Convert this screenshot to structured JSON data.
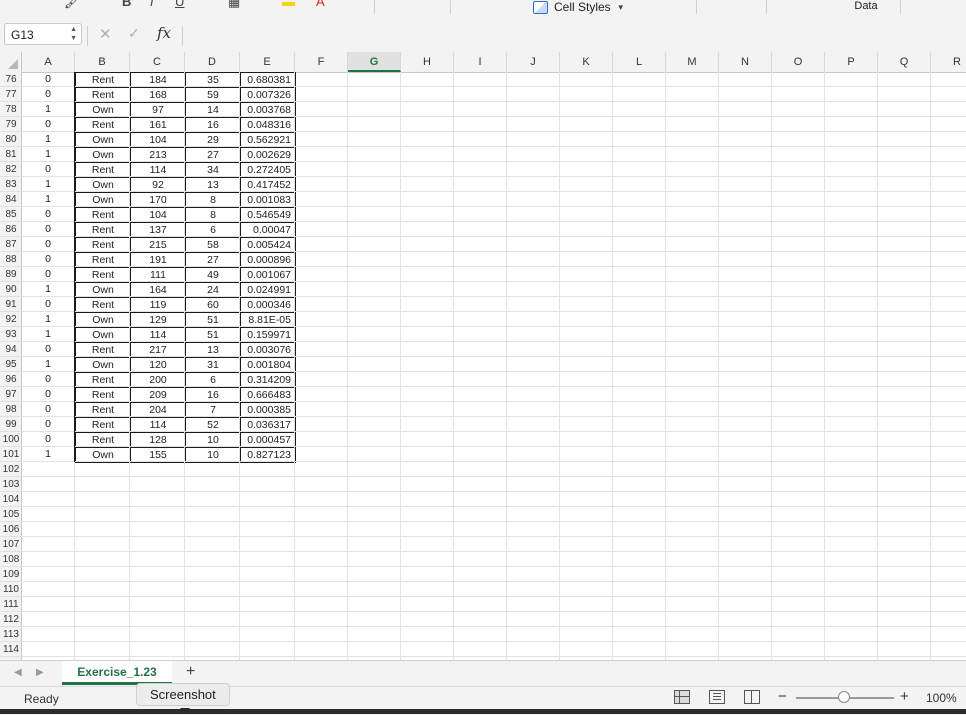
{
  "ribbon": {
    "cell_styles_label": "Cell Styles",
    "data_label": "Data"
  },
  "formula_bar": {
    "name_box": "G13",
    "fx_label": "fx",
    "formula_value": ""
  },
  "columns": [
    "A",
    "B",
    "C",
    "D",
    "E",
    "F",
    "G",
    "H",
    "I",
    "J",
    "K",
    "L",
    "M",
    "N",
    "O",
    "P",
    "Q",
    "R"
  ],
  "selected_column": "G",
  "rows": [
    {
      "n": "76",
      "a": "0",
      "b": "Rent",
      "c": "184",
      "d": "35",
      "e": "0.680381"
    },
    {
      "n": "77",
      "a": "0",
      "b": "Rent",
      "c": "168",
      "d": "59",
      "e": "0.007326"
    },
    {
      "n": "78",
      "a": "1",
      "b": "Own",
      "c": "97",
      "d": "14",
      "e": "0.003768"
    },
    {
      "n": "79",
      "a": "0",
      "b": "Rent",
      "c": "161",
      "d": "16",
      "e": "0.048316"
    },
    {
      "n": "80",
      "a": "1",
      "b": "Own",
      "c": "104",
      "d": "29",
      "e": "0.562921"
    },
    {
      "n": "81",
      "a": "1",
      "b": "Own",
      "c": "213",
      "d": "27",
      "e": "0.002629"
    },
    {
      "n": "82",
      "a": "0",
      "b": "Rent",
      "c": "114",
      "d": "34",
      "e": "0.272405"
    },
    {
      "n": "83",
      "a": "1",
      "b": "Own",
      "c": "92",
      "d": "13",
      "e": "0.417452"
    },
    {
      "n": "84",
      "a": "1",
      "b": "Own",
      "c": "170",
      "d": "8",
      "e": "0.001083"
    },
    {
      "n": "85",
      "a": "0",
      "b": "Rent",
      "c": "104",
      "d": "8",
      "e": "0.546549"
    },
    {
      "n": "86",
      "a": "0",
      "b": "Rent",
      "c": "137",
      "d": "6",
      "e": "0.00047"
    },
    {
      "n": "87",
      "a": "0",
      "b": "Rent",
      "c": "215",
      "d": "58",
      "e": "0.005424"
    },
    {
      "n": "88",
      "a": "0",
      "b": "Rent",
      "c": "191",
      "d": "27",
      "e": "0.000896"
    },
    {
      "n": "89",
      "a": "0",
      "b": "Rent",
      "c": "111",
      "d": "49",
      "e": "0.001067"
    },
    {
      "n": "90",
      "a": "1",
      "b": "Own",
      "c": "164",
      "d": "24",
      "e": "0.024991"
    },
    {
      "n": "91",
      "a": "0",
      "b": "Rent",
      "c": "119",
      "d": "60",
      "e": "0.000346"
    },
    {
      "n": "92",
      "a": "1",
      "b": "Own",
      "c": "129",
      "d": "51",
      "e": "8.81E-05"
    },
    {
      "n": "93",
      "a": "1",
      "b": "Own",
      "c": "114",
      "d": "51",
      "e": "0.159971"
    },
    {
      "n": "94",
      "a": "0",
      "b": "Rent",
      "c": "217",
      "d": "13",
      "e": "0.003076"
    },
    {
      "n": "95",
      "a": "1",
      "b": "Own",
      "c": "120",
      "d": "31",
      "e": "0.001804"
    },
    {
      "n": "96",
      "a": "0",
      "b": "Rent",
      "c": "200",
      "d": "6",
      "e": "0.314209"
    },
    {
      "n": "97",
      "a": "0",
      "b": "Rent",
      "c": "209",
      "d": "16",
      "e": "0.666483"
    },
    {
      "n": "98",
      "a": "0",
      "b": "Rent",
      "c": "204",
      "d": "7",
      "e": "0.000385"
    },
    {
      "n": "99",
      "a": "0",
      "b": "Rent",
      "c": "114",
      "d": "52",
      "e": "0.036317"
    },
    {
      "n": "100",
      "a": "0",
      "b": "Rent",
      "c": "128",
      "d": "10",
      "e": "0.000457"
    },
    {
      "n": "101",
      "a": "1",
      "b": "Own",
      "c": "155",
      "d": "10",
      "e": "0.827123"
    }
  ],
  "empty_rows": [
    "102",
    "103",
    "104",
    "105",
    "106",
    "107",
    "108",
    "109",
    "110",
    "111",
    "112",
    "113",
    "114"
  ],
  "sheet_tab": "Exercise_1.23",
  "add_sheet": "+",
  "status": {
    "ready": "Ready",
    "tooltip": "Screenshot",
    "zoom_minus": "−",
    "zoom_plus": "+",
    "zoom": "100%"
  },
  "colors": {
    "accent": "#217346"
  }
}
